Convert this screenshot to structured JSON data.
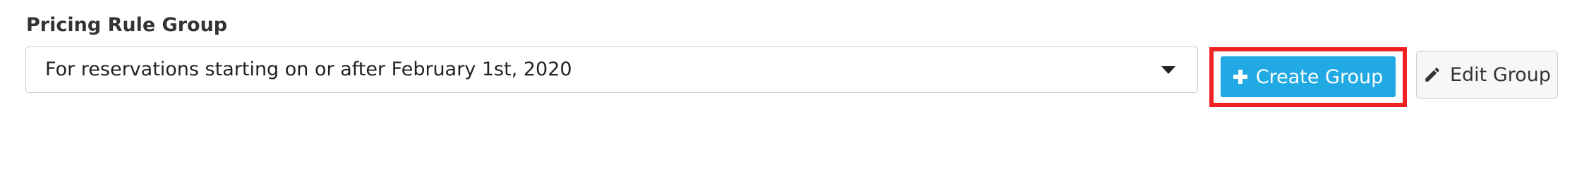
{
  "form": {
    "label": "Pricing Rule Group",
    "select": {
      "selected_value": "For reservations starting on or after February 1st, 2020",
      "caret_icon": "caret-down-icon"
    }
  },
  "actions": {
    "create_label": "Create Group",
    "create_icon": "plus-icon",
    "edit_label": "Edit Group",
    "edit_icon": "pencil-icon"
  },
  "colors": {
    "create_button_bg": "#21a9e3",
    "highlight_border": "#ee2222",
    "label_text": "#333333"
  }
}
